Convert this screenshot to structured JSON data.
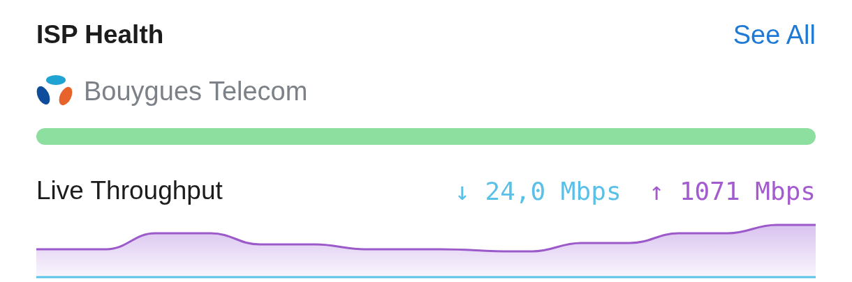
{
  "header": {
    "title": "ISP Health",
    "link": "See All"
  },
  "provider": {
    "name": "Bouygues Telecom"
  },
  "health_bar": {
    "level": 1
  },
  "throughput": {
    "label": "Live Throughput",
    "download": "↓ 24,0 Mbps",
    "upload": "↑ 1071 Mbps"
  }
}
